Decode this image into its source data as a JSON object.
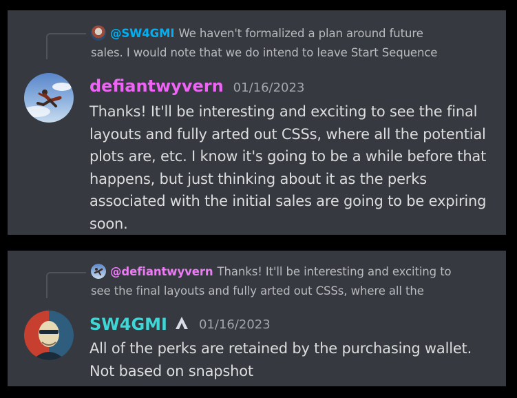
{
  "messages": [
    {
      "reply": {
        "mention": "@SW4GMI",
        "line1": "We haven't formalized a plan around future",
        "line2": "sales. I would note that we do intend to leave Start Sequence"
      },
      "author": "defiantwyvern",
      "author_color": "#ee65f5",
      "timestamp": "01/16/2023",
      "lines": [
        "Thanks! It'll be interesting and exciting to see the final",
        "layouts and fully arted out CSSs, where all the potential",
        "plots are, etc. I know it's going to be a while before that",
        "happens, but just thinking about it as the perks",
        "associated with the initial sales are going to be expiring",
        "soon."
      ]
    },
    {
      "reply": {
        "mention": "@defiantwyvern",
        "line1": "Thanks! It'll be interesting and exciting to",
        "line2": "see the final layouts and fully arted out CSSs, where all the"
      },
      "author": "SW4GMI",
      "author_color": "#3fd6d6",
      "timestamp": "01/16/2023",
      "lines": [
        "All of the perks are retained by the purchasing wallet.",
        "Not based on snapshot"
      ]
    }
  ]
}
